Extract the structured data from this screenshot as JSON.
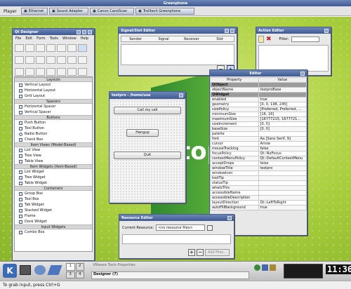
{
  "app_title": "Greenphone",
  "menu": [
    "Player"
  ],
  "tasks": [
    "Ethernet",
    "Sound Adapter",
    "Canon CanoScan",
    "Trolltech Greenphone"
  ],
  "designer": {
    "title": "Qt Designer",
    "menu": [
      "File",
      "Edit",
      "Form",
      "Tools",
      "Window",
      "Help"
    ],
    "sections": [
      {
        "name": "Layouts",
        "items": [
          "Vertical Layout",
          "Horizontal Layout",
          "Grid Layout"
        ]
      },
      {
        "name": "Spacers",
        "items": [
          "Horizontal Spacer",
          "Vertical Spacer"
        ]
      },
      {
        "name": "Buttons",
        "items": [
          "Push Button",
          "Tool Button",
          "Radio Button",
          "Check Box"
        ]
      },
      {
        "name": "Item Views (Model-Based)",
        "items": [
          "List View",
          "Tree View",
          "Table View"
        ]
      },
      {
        "name": "Item Widgets (Item-Based)",
        "items": [
          "List Widget",
          "Tree Widget",
          "Table Widget"
        ]
      },
      {
        "name": "Containers",
        "items": [
          "Group Box",
          "Tool Box",
          "Tab Widget",
          "Stacked Widget",
          "Frame",
          "Dock Widget"
        ]
      },
      {
        "name": "Input Widgets",
        "items": [
          "Combo Box"
        ]
      }
    ]
  },
  "signal_slot": {
    "title": "Signal/Slot Editor",
    "cols": [
      "Sender",
      "Signal",
      "Receiver",
      "Slot"
    ]
  },
  "action_editor": {
    "title": "Action Editor",
    "filter_label": "Filter:"
  },
  "property_editor": {
    "title": "Editor",
    "cols": [
      "Property",
      "Value"
    ],
    "rows": [
      [
        "QObject",
        ""
      ],
      [
        "objectName",
        "testproBase"
      ],
      [
        "QWidget",
        ""
      ],
      [
        "enabled",
        "true"
      ],
      [
        "geometry",
        "[0, 0, 198, 245]"
      ],
      [
        "sizePolicy",
        "[Preferred, Preferred, ..."
      ],
      [
        "minimumSize",
        "[16, 16]"
      ],
      [
        "maximumSize",
        "[16777215, 1677721..."
      ],
      [
        "sizeIncrement",
        "[0, 0]"
      ],
      [
        "baseSize",
        "[0, 0]"
      ],
      [
        "palette",
        ""
      ],
      [
        "font",
        "Aa  [Sans Serif, 9]"
      ],
      [
        "cursor",
        "Arrow"
      ],
      [
        "mouseTracking",
        "false"
      ],
      [
        "focusPolicy",
        "Qt::NoFocus"
      ],
      [
        "contextMenuPolicy",
        "Qt::DefaultContextMenu"
      ],
      [
        "acceptDrops",
        "false"
      ],
      [
        "windowTitle",
        "testpro"
      ],
      [
        "windowIcon",
        ""
      ],
      [
        "toolTip",
        ""
      ],
      [
        "statusTip",
        ""
      ],
      [
        "whatsThis",
        ""
      ],
      [
        "accessibleName",
        ""
      ],
      [
        "accessibleDescription",
        ""
      ],
      [
        "layoutDirection",
        "Qt::LeftToRight"
      ],
      [
        "autoFillBackground",
        "true"
      ]
    ]
  },
  "testpro": {
    "title": "testpro - /home/use",
    "buttons": [
      "Call my cell",
      "Hangup",
      "Quit"
    ]
  },
  "resource": {
    "title": "Resource Editor",
    "label": "Current Resource:",
    "combo": "<no resource files>",
    "add": "Add Files..."
  },
  "taskbar": {
    "row1": [
      "VMware Tools Properties"
    ],
    "row2": [
      "Designer (7)"
    ],
    "desktops": [
      "1",
      "2",
      "3",
      "4"
    ],
    "clock": "11:36"
  },
  "status": "To grab input, press Ctrl+G",
  "brand": "top"
}
